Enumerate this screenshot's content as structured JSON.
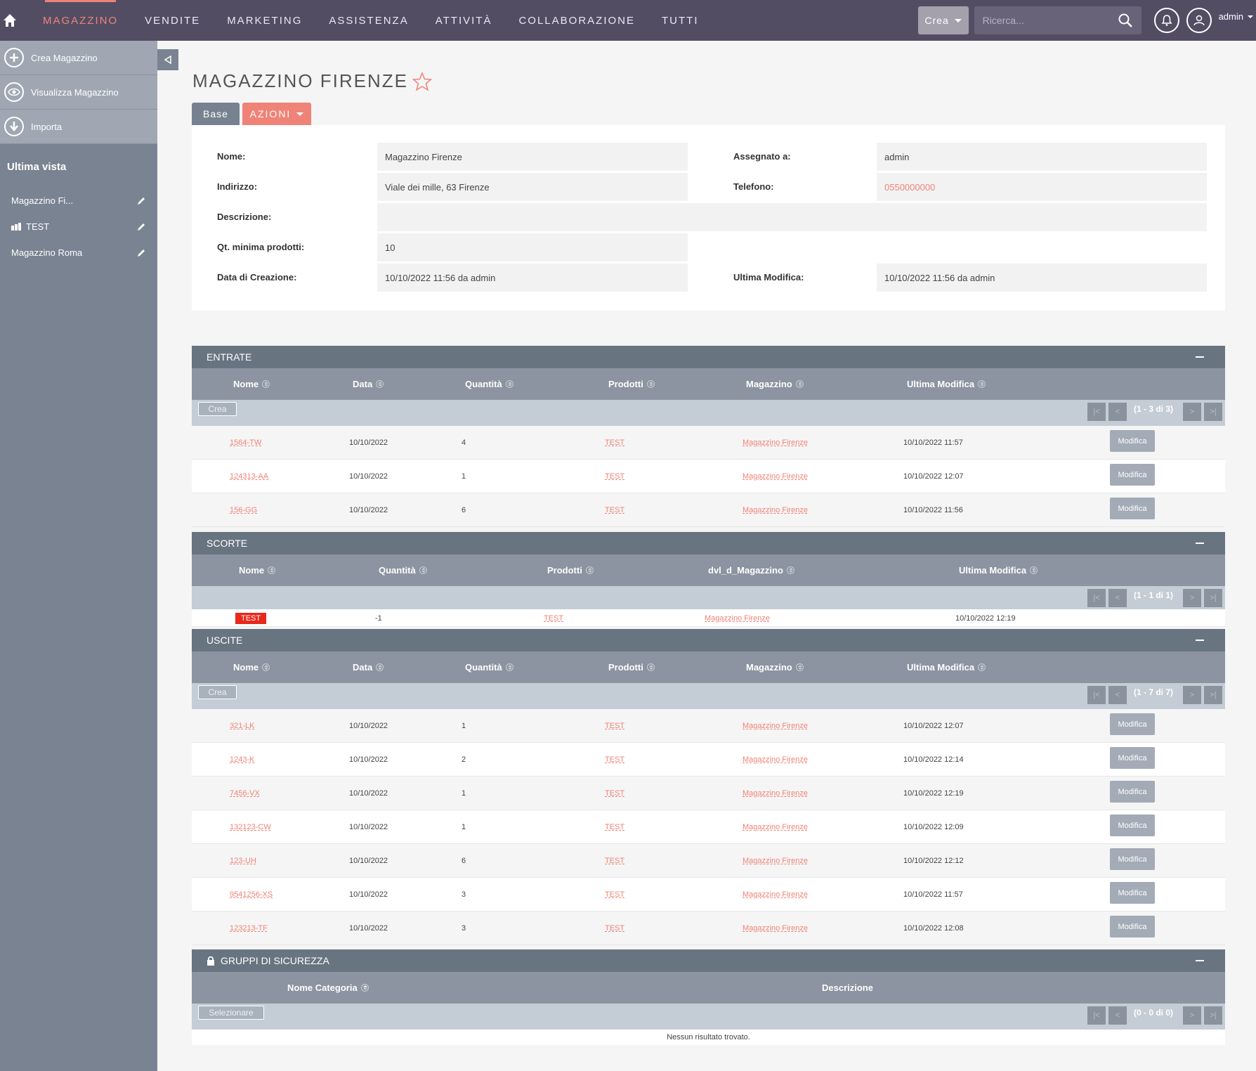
{
  "topnav": {
    "items": [
      "MAGAZZINO",
      "VENDITE",
      "MARKETING",
      "ASSISTENZA",
      "ATTIVITÀ",
      "COLLABORAZIONE",
      "TUTTI"
    ],
    "crea_label": "Crea",
    "search_placeholder": "Ricerca...",
    "user": "admin"
  },
  "sidebar": {
    "actions": [
      "Crea Magazzino",
      "Visualizza Magazzino",
      "Importa"
    ],
    "recent_title": "Ultima vista",
    "recent": [
      "Magazzino Fi...",
      "TEST",
      "Magazzino Roma"
    ]
  },
  "record": {
    "title": "MAGAZZINO FIRENZE",
    "tab_base": "Base",
    "tab_azioni": "AZIONI",
    "fields": {
      "nome_label": "Nome:",
      "nome": "Magazzino Firenze",
      "assegnato_label": "Assegnato a:",
      "assegnato": "admin",
      "indirizzo_label": "Indirizzo:",
      "indirizzo": "Viale dei mille, 63 Firenze",
      "telefono_label": "Telefono:",
      "telefono": "0550000000",
      "descrizione_label": "Descrizione:",
      "descrizione": "",
      "qt_label": "Qt. minima prodotti:",
      "qt": "10",
      "creazione_label": "Data di Creazione:",
      "creazione": "10/10/2022 11:56 da admin",
      "modifica_label": "Ultima Modifica:",
      "modifica": "10/10/2022 11:56 da admin"
    }
  },
  "entrate": {
    "title": "ENTRATE",
    "columns": [
      "Nome",
      "Data",
      "Quantità",
      "Prodotti",
      "Magazzino",
      "Ultima Modifica"
    ],
    "create_label": "Crea",
    "pager": "(1 - 3 di 3)",
    "edit_label": "Modifica",
    "rows": [
      [
        "1564-TW",
        "10/10/2022",
        "4",
        "TEST",
        "Magazzino Firenze",
        "10/10/2022 11:57"
      ],
      [
        "124313-AA",
        "10/10/2022",
        "1",
        "TEST",
        "Magazzino Firenze",
        "10/10/2022 12:07"
      ],
      [
        "156-GG",
        "10/10/2022",
        "6",
        "TEST",
        "Magazzino Firenze",
        "10/10/2022 11:56"
      ]
    ]
  },
  "scorte": {
    "title": "SCORTE",
    "columns": [
      "Nome",
      "Quantità",
      "Prodotti",
      "dvl_d_Magazzino",
      "Ultima Modifica"
    ],
    "pager": "(1 - 1 di 1)",
    "rows": [
      [
        "TEST",
        "-1",
        "TEST",
        "Magazzino Firenze",
        "10/10/2022 12:19"
      ]
    ]
  },
  "uscite": {
    "title": "USCITE",
    "columns": [
      "Nome",
      "Data",
      "Quantità",
      "Prodotti",
      "Magazzino",
      "Ultima Modifica"
    ],
    "create_label": "Crea",
    "pager": "(1 - 7 di 7)",
    "edit_label": "Modifica",
    "rows": [
      [
        "321-LK",
        "10/10/2022",
        "1",
        "TEST",
        "Magazzino Firenze",
        "10/10/2022 12:07"
      ],
      [
        "1243-K",
        "10/10/2022",
        "2",
        "TEST",
        "Magazzino Firenze",
        "10/10/2022 12:14"
      ],
      [
        "7456-VX",
        "10/10/2022",
        "1",
        "TEST",
        "Magazzino Firenze",
        "10/10/2022 12:19"
      ],
      [
        "132123-CW",
        "10/10/2022",
        "1",
        "TEST",
        "Magazzino Firenze",
        "10/10/2022 12:09"
      ],
      [
        "123-UH",
        "10/10/2022",
        "6",
        "TEST",
        "Magazzino Firenze",
        "10/10/2022 12:12"
      ],
      [
        "9541256-XS",
        "10/10/2022",
        "3",
        "TEST",
        "Magazzino Firenze",
        "10/10/2022 11:57"
      ],
      [
        "123213-TF",
        "10/10/2022",
        "3",
        "TEST",
        "Magazzino Firenze",
        "10/10/2022 12:08"
      ]
    ]
  },
  "gruppi": {
    "title": "GRUPPI DI SICUREZZA",
    "columns": [
      "Nome Categoria",
      "Descrizione"
    ],
    "select_label": "Selezionare",
    "pager": "(0 - 0 di 0)",
    "empty": "Nessun risultato trovato."
  },
  "colors": {
    "accent": "#f08377",
    "topbar": "#534d64",
    "sidebar": "#7a8391",
    "panel_header": "#697481"
  }
}
